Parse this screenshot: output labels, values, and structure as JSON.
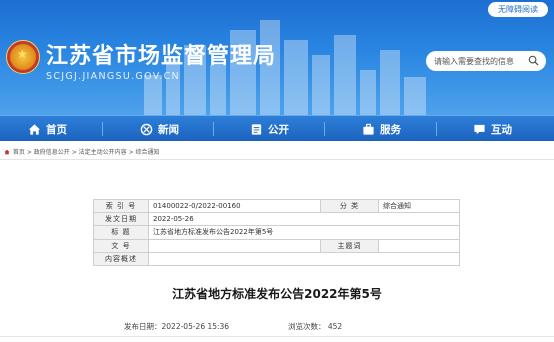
{
  "header": {
    "accessibility_label": "无障碍阅读",
    "site_title": "江苏省市场监督管理局",
    "site_url": "SCJGJ.JIANGSU.GOV.CN",
    "search_placeholder": "请输入需要查找的信息"
  },
  "nav": {
    "items": [
      {
        "label": "首页",
        "icon": "home-icon"
      },
      {
        "label": "新闻",
        "icon": "news-icon"
      },
      {
        "label": "公开",
        "icon": "public-icon"
      },
      {
        "label": "服务",
        "icon": "service-icon"
      },
      {
        "label": "互动",
        "icon": "interact-icon"
      }
    ]
  },
  "breadcrumb": {
    "items": [
      "首页",
      "政府信息公开",
      "法定主动公开内容",
      "综合通知"
    ],
    "separator": " > "
  },
  "info_table": {
    "index_label": "索 引 号",
    "index_value": "01400022-0/2022-00160",
    "category_label": "分 类",
    "category_value": "综合通知",
    "date_label": "发文日期",
    "date_value": "2022-05-26",
    "title_label": "标 题",
    "title_value": "江苏省地方标准发布公告2022年第5号",
    "docno_label": "文 号",
    "docno_value": "",
    "subject_label": "主题词",
    "subject_value": "",
    "summary_label": "内容概述",
    "summary_value": ""
  },
  "article": {
    "title": "江苏省地方标准发布公告2022年第5号",
    "publish_date": "发布日期：2022-05-26 15:36",
    "views": "浏览次数：  452"
  },
  "colors": {
    "header_blue": "#1d6fd1",
    "nav_blue": "#1c63c0"
  }
}
